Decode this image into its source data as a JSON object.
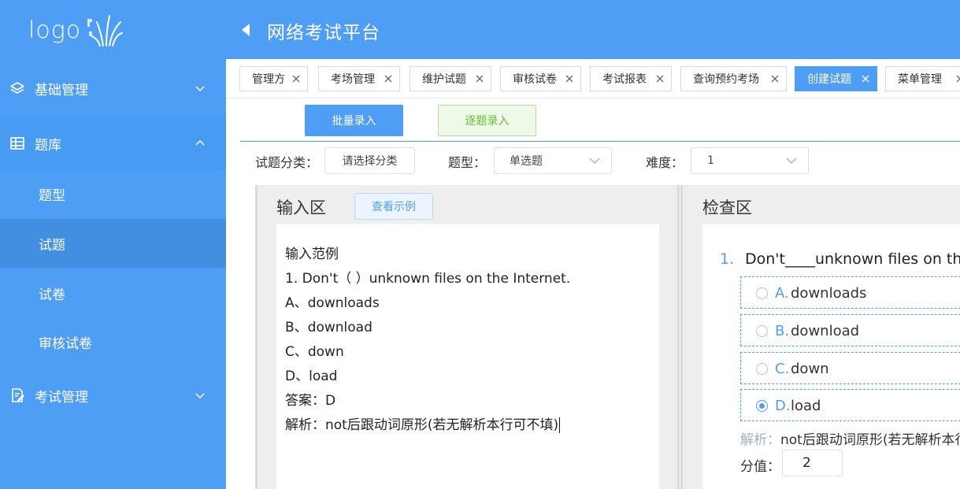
{
  "sidebar": {
    "logo_text": "logo",
    "groups": [
      {
        "label": "基础管理",
        "icon": "layers-icon",
        "expanded": false
      },
      {
        "label": "题库",
        "icon": "database-icon",
        "expanded": true
      },
      {
        "label": "考试管理",
        "icon": "edit-document-icon",
        "expanded": false
      }
    ],
    "sub_items": [
      {
        "label": "题型",
        "active": false
      },
      {
        "label": "试题",
        "active": true
      },
      {
        "label": "试卷",
        "active": false
      },
      {
        "label": "审核试卷",
        "active": false
      }
    ]
  },
  "header": {
    "title": "网络考试平台",
    "back_icon": "caret-left-icon"
  },
  "tabs": [
    {
      "label": "管理方",
      "active": false
    },
    {
      "label": "考场管理",
      "active": false
    },
    {
      "label": "维护试题",
      "active": false
    },
    {
      "label": "审核试卷",
      "active": false
    },
    {
      "label": "考试报表",
      "active": false
    },
    {
      "label": "查询预约考场",
      "active": false
    },
    {
      "label": "创建试题",
      "active": true
    },
    {
      "label": "菜单管理",
      "active": false
    }
  ],
  "actions": {
    "batch_label": "批量录入",
    "single_label": "逐题录入"
  },
  "filters": {
    "category_label": "试题分类：",
    "category_value": "请选择分类",
    "type_label": "题型：",
    "type_value": "单选题",
    "difficulty_label": "难度：",
    "difficulty_value": "1"
  },
  "input_area": {
    "title": "输入区",
    "example_button": "查看示例",
    "lines": [
      "输入范例",
      "1. Don't（  ）unknown files on the Internet.",
      "A、downloads",
      "B、download",
      "C、down",
      "D、load",
      "答案：D",
      "解析：not后跟动词原形(若无解析本行可不填)"
    ]
  },
  "check_area": {
    "title": "检查区",
    "question_number": "1.",
    "question_text": "Don't____unknown files on the Internet.",
    "options": [
      {
        "letter": "A.",
        "text": "downloads",
        "selected": false
      },
      {
        "letter": "B.",
        "text": "download",
        "selected": false
      },
      {
        "letter": "C.",
        "text": "down",
        "selected": false
      },
      {
        "letter": "D.",
        "text": "load",
        "selected": true
      }
    ],
    "analysis_label": "解析：",
    "analysis_text": "not后跟动词原形(若无解析本行可不填)",
    "score_label": "分值：",
    "score_value": "2"
  },
  "colors": {
    "primary": "#4f9ef5",
    "sidebar_active": "#428fe2",
    "success": "#67c23a"
  }
}
